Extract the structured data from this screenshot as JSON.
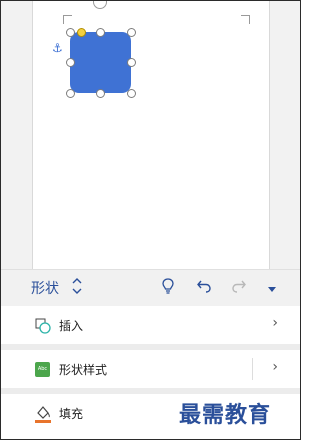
{
  "toolbar": {
    "label": "形状",
    "icons": [
      "expand-arrows-icon",
      "lightbulb-icon",
      "undo-icon",
      "redo-icon",
      "more-dropdown-icon"
    ]
  },
  "menu": {
    "items": [
      {
        "label": "插入",
        "icon": "insert-shape-icon"
      },
      {
        "label": "形状样式",
        "icon": "shape-styles-icon",
        "icon_text": "Abc"
      },
      {
        "label": "填充",
        "icon": "fill-bucket-icon"
      }
    ]
  },
  "watermark": "最需教育",
  "colors": {
    "shape": "#3f72d4",
    "accent": "#2a4f9a",
    "fill_icon_accent": "#e8742c"
  }
}
